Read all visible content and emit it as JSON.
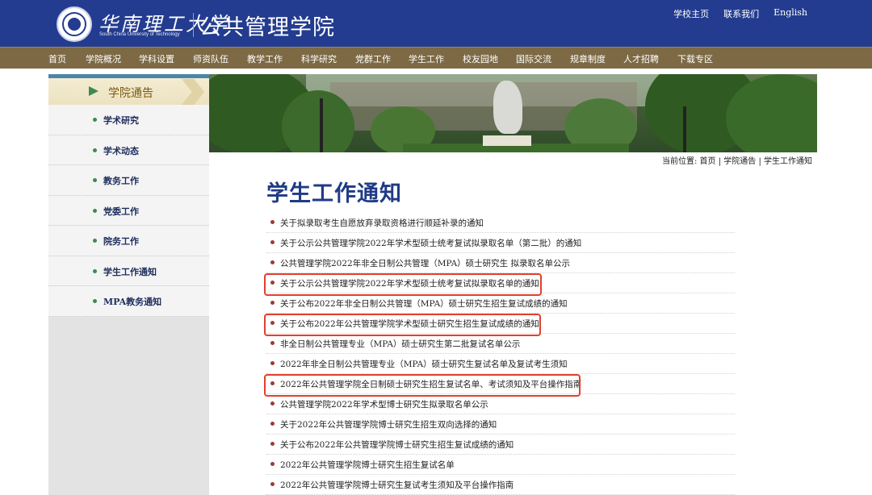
{
  "header": {
    "university_name_cn": "华南理工大学",
    "university_name_en": "South China University of Technology",
    "school_name": "公共管理学院",
    "links": [
      "学校主页",
      "联系我们",
      "English"
    ]
  },
  "nav": {
    "items": [
      "首页",
      "学院概况",
      "学科设置",
      "师资队伍",
      "教学工作",
      "科学研究",
      "党群工作",
      "学生工作",
      "校友园地",
      "国际交流",
      "规章制度",
      "人才招聘",
      "下载专区"
    ]
  },
  "sidebar": {
    "title": "学院通告",
    "items": [
      "学术研究",
      "学术动态",
      "教务工作",
      "党委工作",
      "院务工作",
      "学生工作通知",
      "MPA教务通知"
    ]
  },
  "breadcrumb": "当前位置:  首页 | 学院通告 | 学生工作通知",
  "main": {
    "title": "学生工作通知",
    "notices": [
      "关于拟录取考生自愿放弃录取资格进行顺延补录的通知",
      "关于公示公共管理学院2022年学术型硕士统考复试拟录取名单（第二批）的通知",
      "公共管理学院2022年非全日制公共管理（MPA）硕士研究生 拟录取名单公示",
      "关于公示公共管理学院2022年学术型硕士统考复试拟录取名单的通知",
      "关于公布2022年非全日制公共管理（MPA）硕士研究生招生复试成绩的通知",
      "关于公布2022年公共管理学院学术型硕士研究生招生复试成绩的通知",
      "非全日制公共管理专业（MPA）硕士研究生第二批复试名单公示",
      "2022年非全日制公共管理专业（MPA）硕士研究生复试名单及复试考生须知",
      "2022年公共管理学院全日制硕士研究生招生复试名单、考试须知及平台操作指南",
      "公共管理学院2022年学术型博士研究生拟录取名单公示",
      "关于2022年公共管理学院博士研究生招生双向选择的通知",
      "关于公布2022年公共管理学院博士研究生招生复试成绩的通知",
      "2022年公共管理学院博士研究生招生复试名单",
      "2022年公共管理学院博士研究生复试考生须知及平台操作指南"
    ]
  },
  "colors": {
    "header_bg": "#233c8f",
    "nav_bg": "#7d6a45",
    "title_blue": "#1f3b86",
    "highlight_red": "#e2402c"
  }
}
